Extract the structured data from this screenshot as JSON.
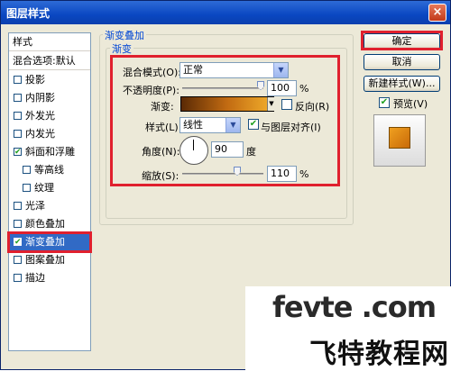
{
  "window": {
    "title": "图层样式",
    "close_label": "×"
  },
  "left_panel": {
    "header": "样式",
    "blend_options": "混合选项:默认",
    "items": [
      {
        "label": "投影",
        "checked": false
      },
      {
        "label": "内阴影",
        "checked": false
      },
      {
        "label": "外发光",
        "checked": false
      },
      {
        "label": "内发光",
        "checked": false
      },
      {
        "label": "斜面和浮雕",
        "checked": true
      },
      {
        "label": "等高线",
        "checked": false
      },
      {
        "label": "纹理",
        "checked": false
      },
      {
        "label": "光泽",
        "checked": false
      },
      {
        "label": "颜色叠加",
        "checked": false
      },
      {
        "label": "渐变叠加",
        "checked": true
      },
      {
        "label": "图案叠加",
        "checked": false
      },
      {
        "label": "描边",
        "checked": false
      }
    ]
  },
  "gradient_overlay": {
    "group_title": "渐变叠加",
    "sub_title": "渐变",
    "blend_mode_label": "混合模式(O):",
    "blend_mode_value": "正常",
    "opacity_label": "不透明度(P):",
    "opacity_value": "100",
    "opacity_unit": "%",
    "gradient_label": "渐变:",
    "reverse_label": "反向(R)",
    "style_label": "样式(L):",
    "style_value": "线性",
    "align_label": "与图层对齐(I)",
    "angle_label": "角度(N):",
    "angle_value": "90",
    "angle_unit": "度",
    "scale_label": "缩放(S):",
    "scale_value": "110",
    "scale_unit": "%"
  },
  "buttons": {
    "ok": "确定",
    "cancel": "取消",
    "new_style": "新建样式(W)...",
    "preview": "预览(V)"
  },
  "watermark": {
    "top": "fevte .com",
    "bottom": "飞特教程网"
  },
  "colors": {
    "accent": "#0046d5",
    "highlight": "#e0202e",
    "selection": "#316ac5"
  }
}
